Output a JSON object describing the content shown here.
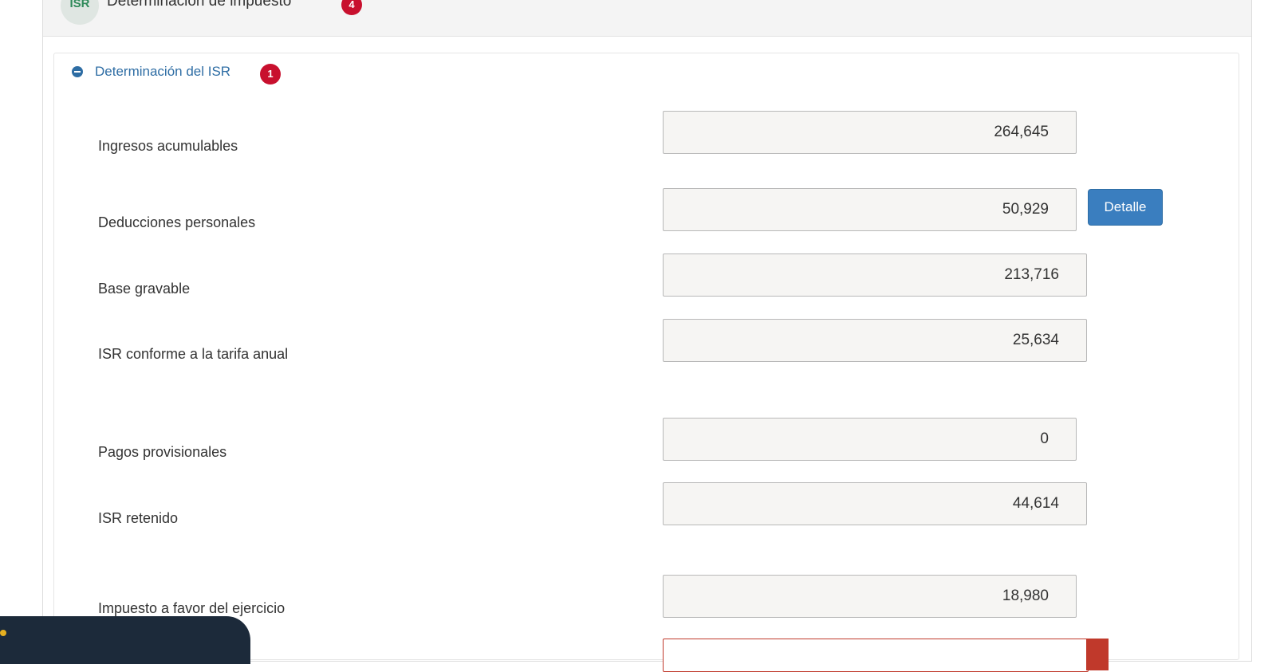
{
  "header": {
    "avatar_text": "ISR",
    "title": "Determinación de impuesto",
    "badge": "4"
  },
  "section": {
    "title": "Determinación del ISR",
    "badge": "1"
  },
  "rows": [
    {
      "label": "Ingresos acumulables",
      "value": "264,645"
    },
    {
      "label": "Deducciones personales",
      "value": "50,929"
    },
    {
      "label": "Base gravable",
      "value": "213,716"
    },
    {
      "label": "ISR conforme a la tarifa anual",
      "value": "25,634"
    },
    {
      "label": "Pagos provisionales",
      "value": "0"
    },
    {
      "label": "ISR retenido",
      "value": "44,614"
    },
    {
      "label": "Impuesto a favor del ejercicio",
      "value": "18,980"
    }
  ],
  "detail_button": "Detalle"
}
